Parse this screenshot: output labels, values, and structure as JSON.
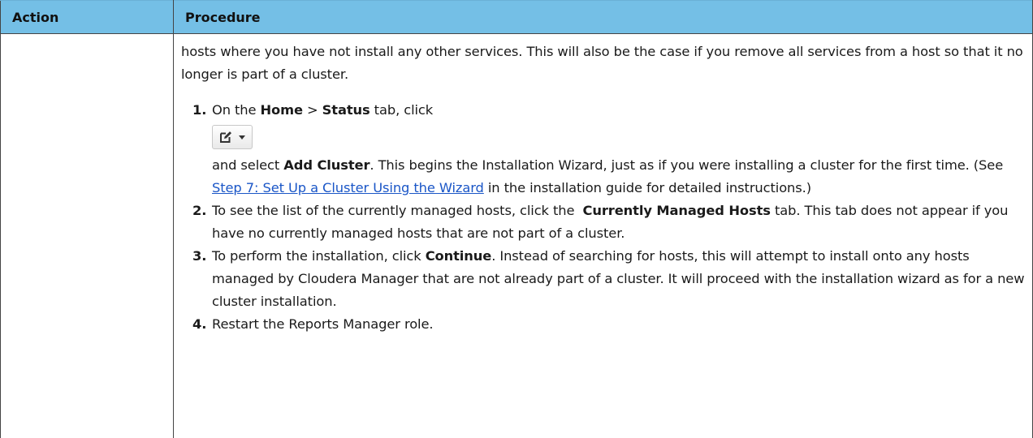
{
  "table": {
    "headers": [
      "Action",
      "Procedure"
    ]
  },
  "procedure": {
    "intro": "hosts where you have not install any other services. This will also be the case if you remove all services from a host so that it no longer is part of a cluster.",
    "steps": [
      {
        "number": "1.",
        "line1_pre": "On the ",
        "home": "Home",
        "sep": " > ",
        "status": "Status",
        "line1_post": " tab, click",
        "pre_select": "and select ",
        "add_cluster": "Add Cluster",
        "post_select": ". This begins the Installation Wizard, just as if you were installing a cluster for the first time. (See ",
        "link": "Step 7: Set Up a Cluster Using the Wizard",
        "post_link": " in the installation guide for detailed instructions.)"
      },
      {
        "number": "2.",
        "pre": "To see the list of the currently managed hosts, click the  ",
        "bold": "Currently Managed Hosts",
        "post": " tab. This tab does not appear if you have no currently managed hosts that are not part of a cluster."
      },
      {
        "number": "3.",
        "pre": "To perform the installation, click ",
        "bold": "Continue",
        "post": ". Instead of searching for hosts, this will attempt to install onto any hosts managed by Cloudera Manager that are not already part of a cluster. It will proceed with the installation wizard as for a new cluster installation."
      },
      {
        "number": "4.",
        "text": "Restart the Reports Manager role."
      }
    ]
  },
  "icons": {
    "edit_button": "edit-icon",
    "dropdown": "caret-down-icon"
  },
  "colors": {
    "header_bg": "#74bfe6",
    "link": "#1a56c7"
  }
}
